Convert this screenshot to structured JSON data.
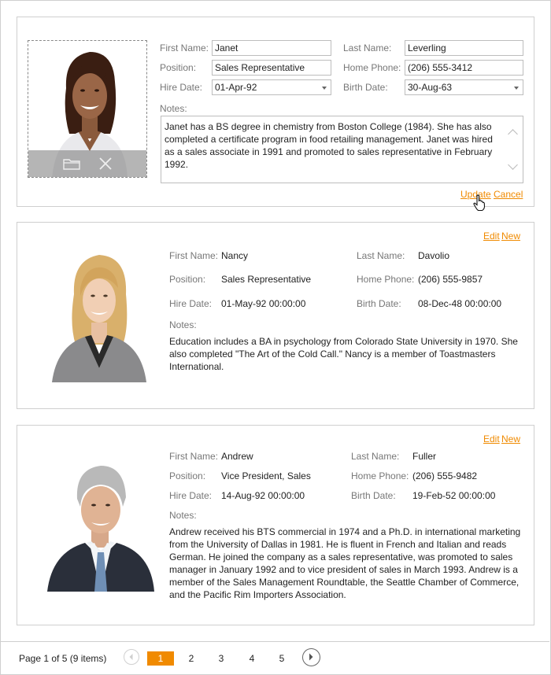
{
  "edit_card": {
    "labels": {
      "first_name": "First Name:",
      "last_name": "Last Name:",
      "position": "Position:",
      "home_phone": "Home Phone:",
      "hire_date": "Hire Date:",
      "birth_date": "Birth Date:",
      "notes": "Notes:"
    },
    "values": {
      "first_name": "Janet",
      "last_name": "Leverling",
      "position": "Sales Representative",
      "home_phone": "(206) 555-3412",
      "hire_date": "01-Apr-92",
      "birth_date": "30-Aug-63",
      "notes": "Janet has a BS degree in chemistry from Boston College (1984). She has also completed a certificate program in food retailing management. Janet was hired as a sales associate in 1991 and promoted to sales representative in February 1992."
    },
    "update_label": "Update",
    "cancel_label": "Cancel"
  },
  "cards": [
    {
      "first_name": "Nancy",
      "last_name": "Davolio",
      "position": "Sales Representative",
      "home_phone": "(206) 555-9857",
      "hire_date": "01-May-92 00:00:00",
      "birth_date": "08-Dec-48 00:00:00",
      "notes": "Education includes a BA in psychology from Colorado State University in 1970. She also completed \"The Art of the Cold Call.\" Nancy is a member of Toastmasters International."
    },
    {
      "first_name": "Andrew",
      "last_name": "Fuller",
      "position": "Vice President, Sales",
      "home_phone": "(206) 555-9482",
      "hire_date": "14-Aug-92 00:00:00",
      "birth_date": "19-Feb-52 00:00:00",
      "notes": "Andrew received his BTS commercial in 1974 and a Ph.D. in international marketing from the University of Dallas in 1981. He is fluent in French and Italian and reads German. He joined the company as a sales representative, was promoted to sales manager in January 1992 and to vice president of sales in March 1993. Andrew is a member of the Sales Management Roundtable, the Seattle Chamber of Commerce, and the Pacific Rim Importers Association."
    }
  ],
  "labels": {
    "first_name": "First Name:",
    "last_name": "Last Name:",
    "position": "Position:",
    "home_phone": "Home Phone:",
    "hire_date": "Hire Date:",
    "birth_date": "Birth Date:",
    "notes": "Notes:",
    "edit": "Edit",
    "new": "New"
  },
  "pager": {
    "summary": "Page 1 of 5 (9 items)",
    "pages": [
      "1",
      "2",
      "3",
      "4",
      "5"
    ],
    "current_page": "1",
    "prev_icon": "chevron-left-icon",
    "next_icon": "chevron-right-icon"
  },
  "icons": {
    "folder": "folder-icon",
    "clear": "close-icon",
    "cursor": "hand-pointer-icon"
  },
  "colors": {
    "accent": "#f08a00",
    "label": "#777777",
    "border": "#cfcfcf"
  }
}
